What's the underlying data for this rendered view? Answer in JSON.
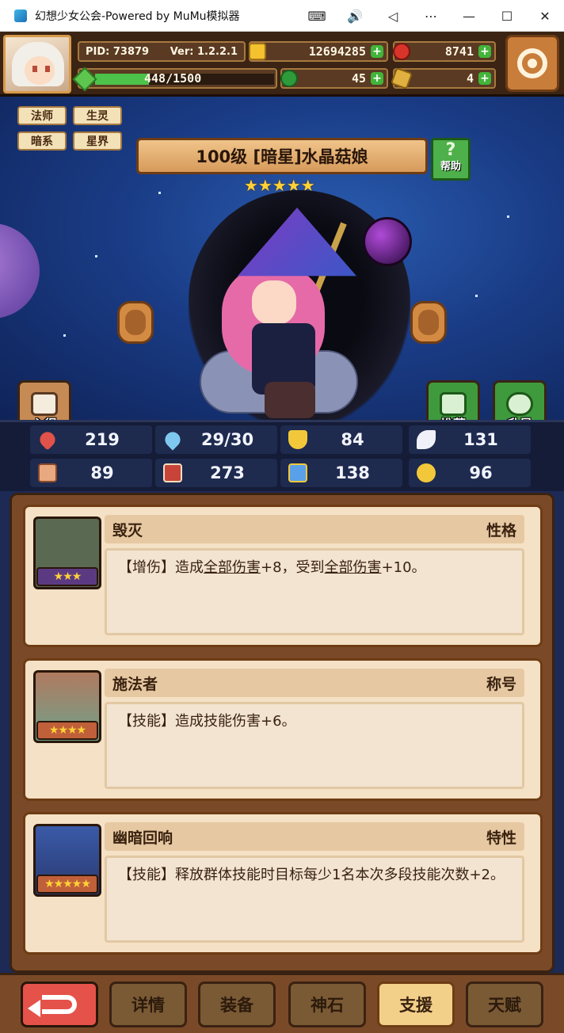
{
  "window": {
    "title": "幻想少女公会-Powered by MuMu模拟器",
    "controls": [
      "⌨",
      "🔊",
      "◁",
      "⋯",
      "—",
      "☐",
      "✕"
    ]
  },
  "hud": {
    "pid": "PID: 73879",
    "version": "Ver: 1.2.2.1",
    "coins": "12694285",
    "gems": "8741",
    "exp_text": "448/1500",
    "exp_progress": 0.2987,
    "clovers": "45",
    "feathers": "4"
  },
  "hero": {
    "tags": [
      "法师",
      "生灵",
      "暗系",
      "星界"
    ],
    "name": "100级 [暗星]水晶菇娘",
    "stars": "★★★★★",
    "help_label": "帮助",
    "help_icon": "?",
    "notes_label": "心得",
    "recommend_label": "推荐",
    "upgrade_label": "升星"
  },
  "stats": [
    {
      "icon": "heart-icon",
      "value": "219",
      "color": "#e0524a"
    },
    {
      "icon": "drop-icon",
      "value": "29/30",
      "color": "#7ec8f0"
    },
    {
      "icon": "shield-icon",
      "value": "84",
      "color": "#f2c83a"
    },
    {
      "icon": "wing-icon",
      "value": "131",
      "color": "#f0f0f8"
    },
    {
      "icon": "fist-icon",
      "value": "89",
      "color": "#e8a880"
    },
    {
      "icon": "book-icon",
      "value": "273",
      "color": "#c8443a"
    },
    {
      "icon": "scroll-icon",
      "value": "138",
      "color": "#5aa0e8"
    },
    {
      "icon": "clock-icon",
      "value": "96",
      "color": "#f2c83a"
    }
  ],
  "cards": [
    {
      "title": "毁灭",
      "type": "性格",
      "desc_prefix": "【增伤】造成",
      "desc_u1": "全部伤害",
      "desc_mid": "+8，受到",
      "desc_u2": "全部伤害",
      "desc_suffix": "+10。",
      "stars": "★★★"
    },
    {
      "title": "施法者",
      "type": "称号",
      "desc": "【技能】造成技能伤害+6。",
      "stars": "★★★★"
    },
    {
      "title": "幽暗回响",
      "type": "特性",
      "desc": "【技能】释放群体技能时目标每少1名本次多段技能次数+2。",
      "stars": "★★★★★"
    }
  ],
  "nav": {
    "tabs": [
      "详情",
      "装备",
      "神石",
      "支援",
      "天赋"
    ],
    "active": "支援"
  }
}
